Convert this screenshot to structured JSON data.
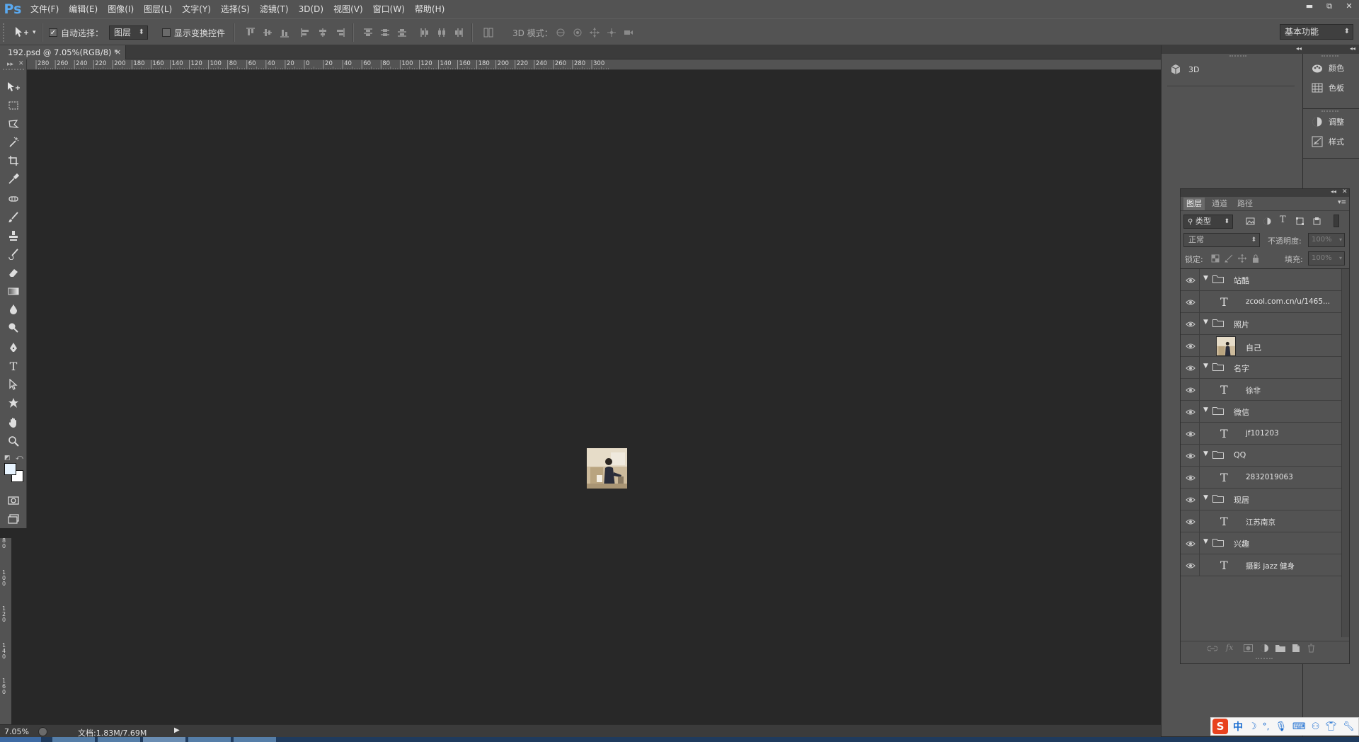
{
  "app": {
    "logo": "Ps"
  },
  "menu": [
    "文件(F)",
    "编辑(E)",
    "图像(I)",
    "图层(L)",
    "文字(Y)",
    "选择(S)",
    "滤镜(T)",
    "3D(D)",
    "视图(V)",
    "窗口(W)",
    "帮助(H)"
  ],
  "window_controls": {
    "minimize": "▬",
    "restore": "⧉",
    "close": "✕"
  },
  "options": {
    "auto_select_label": "自动选择：",
    "auto_select_checked": true,
    "auto_select_value": "图层",
    "show_transform_label": "显示变换控件",
    "show_transform_checked": false,
    "mode_3d_label": "3D 模式：",
    "workspace": "基本功能"
  },
  "document": {
    "tab_title": "192.psd @ 7.05%(RGB/8) *",
    "close": "×",
    "zoom": "7.05%",
    "doc_info": "文档:1.83M/7.69M"
  },
  "ruler": {
    "labels": [
      "280",
      "260",
      "240",
      "220",
      "200",
      "180",
      "160",
      "140",
      "120",
      "100",
      "80",
      "60",
      "40",
      "20",
      "0",
      "20",
      "40",
      "60",
      "80",
      "100",
      "120",
      "140",
      "160",
      "180",
      "200",
      "220",
      "240",
      "260",
      "280",
      "300"
    ],
    "vertical_labels": [
      "8",
      "0",
      "1",
      "0",
      "0",
      "1",
      "2",
      "0",
      "1",
      "4",
      "0",
      "1",
      "6",
      "0"
    ]
  },
  "right_panels": {
    "panel_3d": "3D",
    "color": "颜色",
    "swatches": "色板",
    "adjustments": "调整",
    "styles": "样式"
  },
  "layers_panel": {
    "tabs": [
      "图层",
      "通道",
      "路径"
    ],
    "filter_kind": "类型",
    "blend_mode": "正常",
    "opacity_label": "不透明度:",
    "opacity_value": "100%",
    "lock_label": "锁定:",
    "fill_label": "填充:",
    "fill_value": "100%",
    "layers": [
      {
        "type": "group",
        "name": "站酷"
      },
      {
        "type": "text",
        "name": "zcool.com.cn/u/1465..."
      },
      {
        "type": "group",
        "name": "照片"
      },
      {
        "type": "image",
        "name": "自己"
      },
      {
        "type": "group",
        "name": "名字"
      },
      {
        "type": "text",
        "name": "徐非"
      },
      {
        "type": "group",
        "name": "微信"
      },
      {
        "type": "text",
        "name": "jf101203"
      },
      {
        "type": "group",
        "name": "QQ"
      },
      {
        "type": "text",
        "name": "2832019063"
      },
      {
        "type": "group",
        "name": "现居"
      },
      {
        "type": "text",
        "name": "江苏南京"
      },
      {
        "type": "group",
        "name": "兴趣"
      },
      {
        "type": "text",
        "name": "摄影  jazz  健身"
      }
    ]
  },
  "ime": {
    "logo": "S",
    "lang": "中"
  },
  "colors": {
    "accent": "#5aa9f0",
    "panel": "#535353",
    "canvas": "#282828",
    "ime_red": "#e8421e"
  }
}
